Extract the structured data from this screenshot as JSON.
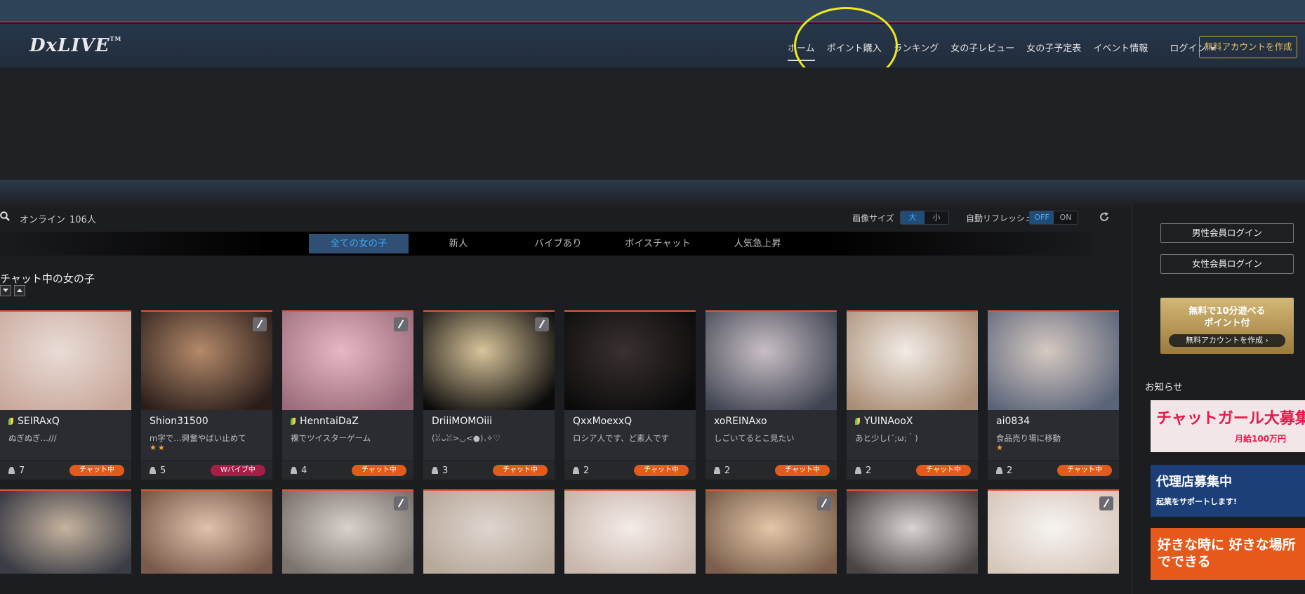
{
  "header": {
    "logo": "DxLIVE",
    "logo_tm": "TM",
    "nav": [
      {
        "label": "ホーム",
        "active": true
      },
      {
        "label": "ポイント購入",
        "active": false
      },
      {
        "label": "ランキング",
        "active": false
      },
      {
        "label": "女の子レビュー",
        "active": false
      },
      {
        "label": "女の子予定表",
        "active": false
      },
      {
        "label": "イベント情報",
        "active": false
      }
    ],
    "login": "ログイン",
    "create_account": "無料アカウントを作成"
  },
  "toolbar": {
    "online_label": "オンライン",
    "online_count": "106人",
    "image_size_label": "画像サイズ",
    "image_size_options": [
      "大",
      "小"
    ],
    "image_size_selected": "大",
    "auto_refresh_label": "自動リフレッシュ",
    "auto_refresh_options": [
      "OFF",
      "ON"
    ],
    "auto_refresh_selected": "OFF"
  },
  "tabs": [
    "全ての女の子",
    "新人",
    "バイブあり",
    "ボイスチャット",
    "人気急上昇"
  ],
  "active_tab": "全ての女の子",
  "section_title": "チャット中の女の子",
  "performers": [
    {
      "name": "SEIRAxQ",
      "newcomer": true,
      "desc": "ぬぎぬぎ…///",
      "stars": 0,
      "viewers": "7",
      "status": "チャット中",
      "edit_badge": false,
      "thumb": [
        "#e9dcd6",
        "#c9a89c"
      ]
    },
    {
      "name": "Shion31500",
      "newcomer": false,
      "desc": "m字で…興奮やばい止めて",
      "stars": 2,
      "viewers": "5",
      "status": "Wバイブ中",
      "edit_badge": true,
      "thumb": [
        "#b48a6a",
        "#2a1d1a"
      ]
    },
    {
      "name": "HenntaiDaZ",
      "newcomer": true,
      "desc": "裸でツイスターゲーム",
      "stars": 0,
      "viewers": "4",
      "status": "チャット中",
      "edit_badge": true,
      "thumb": [
        "#e8b7c4",
        "#9a6b7a"
      ]
    },
    {
      "name": "DriiiMOMOiii",
      "newcomer": false,
      "desc": "(ꈍᴗꈍ>◡<●)｡✧♡",
      "stars": 0,
      "viewers": "3",
      "status": "チャット中",
      "edit_badge": true,
      "thumb": [
        "#d9c49a",
        "#0b0b0b"
      ]
    },
    {
      "name": "QxxMoexxQ",
      "newcomer": false,
      "desc": "ロシア人です、ど素人です",
      "stars": 0,
      "viewers": "2",
      "status": "チャット中",
      "edit_badge": false,
      "thumb": [
        "#3a3030",
        "#0a0a0a"
      ]
    },
    {
      "name": "xoREINAxo",
      "newcomer": false,
      "desc": "しごいてるとこ見たい",
      "stars": 0,
      "viewers": "2",
      "status": "チャット中",
      "edit_badge": false,
      "thumb": [
        "#c9bfc6",
        "#3f4450"
      ]
    },
    {
      "name": "YUINAooX",
      "newcomer": true,
      "desc": "あと少し(´;ω;｀)",
      "stars": 0,
      "viewers": "2",
      "status": "チャット中",
      "edit_badge": false,
      "thumb": [
        "#f1ece6",
        "#a98c74"
      ]
    },
    {
      "name": "ai0834",
      "newcomer": false,
      "desc": "食品売り場に移動",
      "stars": 1,
      "viewers": "2",
      "status": "チャット中",
      "edit_badge": false,
      "thumb": [
        "#d6c9c2",
        "#5a6478"
      ]
    }
  ],
  "row2_thumbs": [
    {
      "colors": [
        "#c6b39f",
        "#3b3d46"
      ],
      "edit_badge": false
    },
    {
      "colors": [
        "#e0c2ae",
        "#7a5a4a"
      ],
      "edit_badge": false
    },
    {
      "colors": [
        "#d9d1cc",
        "#7a736e"
      ],
      "edit_badge": true
    },
    {
      "colors": [
        "#ded6cf",
        "#b8a89a"
      ],
      "edit_badge": false
    },
    {
      "colors": [
        "#f3ece8",
        "#c9b6ac"
      ],
      "edit_badge": false
    },
    {
      "colors": [
        "#e2c7a9",
        "#7b5f4b"
      ],
      "edit_badge": true
    },
    {
      "colors": [
        "#dad3d4",
        "#4a4444"
      ],
      "edit_badge": false
    },
    {
      "colors": [
        "#f6f4f2",
        "#d8c8bc"
      ],
      "edit_badge": true
    }
  ],
  "sidebar": {
    "male_login": "男性会員ログイン",
    "female_login": "女性会員ログイン",
    "promo_line1": "無料で10分遊べる",
    "promo_line2": "ポイント付",
    "promo_button": "無料アカウントを作成",
    "news_title": "お知らせ",
    "ads": [
      {
        "text": "チャットガール大募集!",
        "sub": "月給100万円",
        "bg": "#f3e6e8",
        "color": "#e6194b"
      },
      {
        "text": "代理店募集中",
        "sub": "起業をサポートします!",
        "bg": "#1c3f7a",
        "color": "#ffffff"
      },
      {
        "text": "好きな時に 好きな場所でできる",
        "sub": "",
        "bg": "#e55a1b",
        "color": "#ffffff"
      }
    ]
  },
  "colors": {
    "accent": "#e4572e",
    "tab_active": "#3ca7f2",
    "gold": "#c9a64a",
    "annotation": "#f0e81a"
  }
}
